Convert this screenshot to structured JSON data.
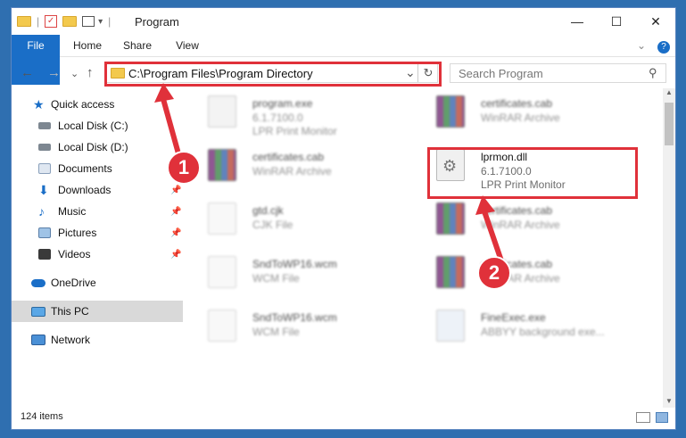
{
  "window": {
    "title": "Program",
    "minimize": "—",
    "maximize": "☐",
    "close": "✕"
  },
  "ribbon": {
    "tabs": [
      "File",
      "Home",
      "Share",
      "View"
    ],
    "help": "?",
    "collapse": "⌄"
  },
  "address": {
    "path": "C:\\Program Files\\Program Directory",
    "dropdown": "⌄",
    "refresh": "↻"
  },
  "search": {
    "placeholder": "Search Program",
    "icon": "⚲"
  },
  "nav": {
    "back": "←",
    "forward": "→",
    "recent": "⌄",
    "up": "↑"
  },
  "sidebar": {
    "items": [
      {
        "label": "Quick access",
        "pinned": false
      },
      {
        "label": "Local Disk (C:)",
        "pinned": false
      },
      {
        "label": "Local Disk (D:)",
        "pinned": false
      },
      {
        "label": "Documents",
        "pinned": false
      },
      {
        "label": "Downloads",
        "pinned": true
      },
      {
        "label": "Music",
        "pinned": true
      },
      {
        "label": "Pictures",
        "pinned": true
      },
      {
        "label": "Videos",
        "pinned": true
      },
      {
        "label": "OneDrive",
        "pinned": false
      },
      {
        "label": "This PC",
        "pinned": false,
        "selected": true
      },
      {
        "label": "Network",
        "pinned": false
      }
    ],
    "pin_glyph": "📌"
  },
  "files": [
    {
      "name": "program.exe",
      "version": "6.1.7100.0",
      "desc": "LPR Print Monitor",
      "icon": "exe"
    },
    {
      "name": "certificates.cab",
      "version": "WinRAR Archive",
      "desc": "",
      "icon": "rar"
    },
    {
      "name": "certificates.cab",
      "version": "WinRAR Archive",
      "desc": "",
      "icon": "rar"
    },
    {
      "name": "lprmon.dll",
      "version": "6.1.7100.0",
      "desc": "LPR Print Monitor",
      "icon": "dll"
    },
    {
      "name": "gtd.cjk",
      "version": "CJK File",
      "desc": "",
      "icon": "doc"
    },
    {
      "name": "certificates.cab",
      "version": "WinRAR Archive",
      "desc": "",
      "icon": "rar"
    },
    {
      "name": "SndToWP16.wcm",
      "version": "WCM File",
      "desc": "",
      "icon": "doc"
    },
    {
      "name": "certificates.cab",
      "version": "WinRAR Archive",
      "desc": "",
      "icon": "rar"
    },
    {
      "name": "SndToWP16.wcm",
      "version": "WCM File",
      "desc": "",
      "icon": "doc"
    },
    {
      "name": "FineExec.exe",
      "version": "ABBYY background exe...",
      "desc": "",
      "icon": "exe"
    }
  ],
  "status": {
    "count": "124 items"
  },
  "annotations": {
    "badge1": "1",
    "badge2": "2"
  },
  "colors": {
    "accent": "#1a6ec7",
    "highlight": "#e0313a"
  }
}
